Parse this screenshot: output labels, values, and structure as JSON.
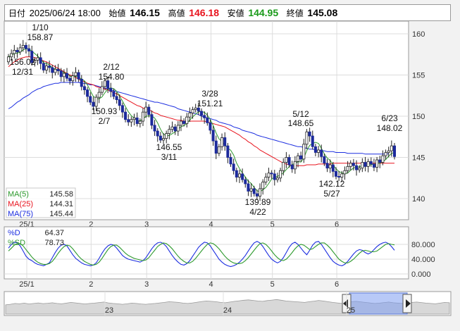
{
  "header": {
    "date_label": "日付",
    "datetime": "2025/06/24 18:00",
    "open_label": "始値",
    "open": "146.15",
    "high_label": "高値",
    "high": "146.18",
    "low_label": "安値",
    "low": "144.95",
    "close_label": "終値",
    "close": "145.08"
  },
  "colors": {
    "up": "#ffffff",
    "down": "#1c2a9c",
    "ma5": "#2e9a2e",
    "ma25": "#e8141e",
    "ma75": "#1c2ee0",
    "pctd": "#1c2ee0",
    "pctsd": "#2e9a2e"
  },
  "chart_data": [
    {
      "type": "candlestick",
      "name": "price",
      "ylim": [
        137.5,
        162.5
      ],
      "yticks": [
        "160",
        "155",
        "150",
        "145",
        "140"
      ],
      "xticks": [
        "25/1",
        "2",
        "3",
        "4",
        "5",
        "6"
      ],
      "legend": [
        {
          "label": "MA(5)",
          "value": "145.58"
        },
        {
          "label": "MA(25)",
          "value": "144.31"
        },
        {
          "label": "MA(75)",
          "value": "145.44"
        }
      ],
      "annotations": [
        {
          "date": "1/10",
          "value": "158.87"
        },
        {
          "date": "12/31",
          "value": "156.02"
        },
        {
          "date": "2/12",
          "value": "154.80"
        },
        {
          "date": "2/7",
          "value": "150.93"
        },
        {
          "date": "3/11",
          "value": "146.55"
        },
        {
          "date": "3/28",
          "value": "151.21"
        },
        {
          "date": "4/22",
          "value": "139.89"
        },
        {
          "date": "5/12",
          "value": "148.65"
        },
        {
          "date": "5/27",
          "value": "142.12"
        },
        {
          "date": "6/23",
          "value": "148.02"
        }
      ],
      "closes": [
        157.2,
        157.6,
        158.0,
        157.8,
        158.3,
        158.6,
        158.2,
        157.9,
        156.5,
        156.8,
        157.1,
        156.4,
        155.6,
        156.1,
        155.9,
        155.3,
        155.7,
        155.5,
        154.8,
        155.2,
        154.6,
        154.3,
        154.9,
        155.3,
        154.5,
        153.6,
        153.2,
        152.4,
        151.7,
        151.2,
        152.3,
        152.9,
        153.6,
        154.3,
        153.4,
        153.0,
        152.4,
        152.0,
        151.3,
        150.5,
        149.6,
        149.3,
        149.6,
        149.8,
        149.1,
        149.4,
        150.5,
        151.1,
        150.2,
        148.9,
        148.2,
        147.6,
        147.1,
        147.3,
        147.9,
        148.4,
        148.7,
        148.2,
        148.9,
        149.4,
        149.1,
        149.9,
        150.4,
        150.8,
        151.0,
        150.6,
        150.1,
        149.8,
        149.2,
        148.3,
        147.0,
        145.5,
        146.3,
        147.4,
        146.4,
        145.0,
        144.2,
        143.4,
        142.6,
        143.0,
        142.3,
        141.8,
        140.9,
        141.2,
        140.6,
        140.3,
        141.2,
        142.0,
        142.6,
        143.1,
        143.0,
        142.3,
        142.5,
        143.4,
        144.4,
        145.0,
        144.1,
        143.6,
        144.5,
        145.2,
        144.8,
        146.6,
        148.1,
        147.6,
        146.3,
        145.6,
        145.9,
        145.1,
        144.3,
        143.7,
        144.1,
        143.3,
        142.7,
        142.6,
        143.0,
        143.4,
        143.9,
        144.3,
        144.0,
        143.5,
        143.7,
        144.4,
        143.9,
        144.5,
        144.2,
        143.8,
        144.7,
        144.4,
        145.2,
        145.6,
        145.8,
        146.4,
        145.1
      ],
      "ma25": [
        156.0,
        156.3,
        156.6,
        156.8,
        157.0,
        157.1,
        157.2,
        157.2,
        157.2,
        157.1,
        157.0,
        156.9,
        156.7,
        156.6,
        156.4,
        156.2,
        156.0,
        155.8,
        155.6,
        155.4,
        155.2,
        155.0,
        154.9,
        154.7,
        154.5,
        154.3,
        154.2,
        154.0,
        153.9,
        153.8,
        153.6,
        153.5,
        153.4,
        153.3,
        153.2,
        153.0,
        152.9,
        152.7,
        152.5,
        152.3,
        152.1,
        151.9,
        151.7,
        151.5,
        151.3,
        151.2,
        151.0,
        150.9,
        150.8,
        150.6,
        150.4,
        150.3,
        150.1,
        150.0,
        149.9,
        149.8,
        149.7,
        149.6,
        149.5,
        149.5,
        149.4,
        149.4,
        149.4,
        149.4,
        149.4,
        149.4,
        149.4,
        149.4,
        149.3,
        149.2,
        149.1,
        149.0,
        148.9,
        148.8,
        148.7,
        148.5,
        148.3,
        148.1,
        147.9,
        147.7,
        147.4,
        147.2,
        146.9,
        146.7,
        146.4,
        146.2,
        145.9,
        145.7,
        145.5,
        145.3,
        145.1,
        144.9,
        144.7,
        144.5,
        144.3,
        144.2,
        144.1,
        144.0,
        144.0,
        144.0,
        144.0,
        144.0,
        144.1,
        144.1,
        144.1,
        144.1,
        144.2,
        144.2,
        144.2,
        144.2,
        144.2,
        144.3,
        144.3,
        144.3,
        144.3,
        144.3,
        144.3,
        144.3,
        144.3,
        144.3,
        144.3,
        144.3,
        144.3,
        144.3,
        144.3,
        144.3,
        144.3,
        144.3,
        144.3,
        144.3,
        144.3,
        144.3,
        144.3
      ],
      "ma75": [
        150.9,
        151.1,
        151.4,
        151.7,
        151.9,
        152.2,
        152.4,
        152.6,
        152.9,
        153.1,
        153.3,
        153.4,
        153.6,
        153.7,
        153.8,
        153.9,
        154.0,
        154.0,
        154.1,
        154.1,
        154.1,
        154.1,
        154.1,
        154.1,
        154.1,
        154.0,
        154.0,
        153.9,
        153.8,
        153.8,
        153.7,
        153.6,
        153.5,
        153.4,
        153.3,
        153.2,
        153.1,
        153.0,
        152.9,
        152.8,
        152.7,
        152.6,
        152.5,
        152.4,
        152.3,
        152.2,
        152.1,
        152.0,
        151.9,
        151.8,
        151.7,
        151.7,
        151.6,
        151.5,
        151.4,
        151.3,
        151.2,
        151.1,
        150.9,
        150.8,
        150.7,
        150.6,
        150.5,
        150.4,
        150.3,
        150.2,
        150.0,
        149.9,
        149.8,
        149.7,
        149.6,
        149.5,
        149.3,
        149.2,
        149.1,
        149.0,
        148.9,
        148.7,
        148.6,
        148.5,
        148.3,
        148.2,
        148.1,
        148.0,
        147.9,
        147.7,
        147.6,
        147.5,
        147.4,
        147.3,
        147.2,
        147.1,
        147.0,
        146.9,
        146.8,
        146.7,
        146.6,
        146.5,
        146.4,
        146.3,
        146.3,
        146.2,
        146.1,
        146.0,
        146.0,
        145.9,
        145.9,
        145.8,
        145.8,
        145.7,
        145.7,
        145.7,
        145.6,
        145.6,
        145.6,
        145.6,
        145.5,
        145.5,
        145.5,
        145.5,
        145.5,
        145.5,
        145.4,
        145.4,
        145.4,
        145.4,
        145.4,
        145.4,
        145.4,
        145.4,
        145.44
      ]
    },
    {
      "type": "line",
      "name": "stochastics",
      "ylim": [
        0,
        100
      ],
      "yticks": [
        "80.000",
        "40.000",
        "0.000"
      ],
      "xticks": [
        "25/1",
        "2",
        "3",
        "4",
        "5",
        "6"
      ],
      "legend": [
        {
          "label": "%D",
          "value": "64.37"
        },
        {
          "label": "%SD",
          "value": "78.73"
        }
      ],
      "series": [
        {
          "name": "%D",
          "values": [
            70,
            80,
            86,
            84,
            76,
            62,
            48,
            40,
            36,
            30,
            26,
            24,
            22,
            26,
            30,
            44,
            58,
            70,
            78,
            80,
            76,
            64,
            52,
            42,
            36,
            30,
            26,
            24,
            22,
            24,
            30,
            42,
            56,
            68,
            76,
            80,
            78,
            70,
            60,
            50,
            44,
            40,
            38,
            36,
            34,
            32,
            36,
            44,
            56,
            68,
            78,
            84,
            86,
            82,
            74,
            62,
            50,
            40,
            32,
            26,
            24,
            28,
            36,
            48,
            60,
            72,
            80,
            86,
            84,
            76,
            64,
            52,
            40,
            32,
            26,
            22,
            20,
            22,
            26,
            32,
            40,
            50,
            62,
            74,
            84,
            88,
            84,
            74,
            62,
            50,
            40,
            34,
            30,
            34,
            44,
            58,
            72,
            82,
            86,
            80,
            70,
            60,
            52,
            64,
            78,
            86,
            88,
            80,
            68,
            56,
            44,
            34,
            28,
            24,
            22,
            26,
            34,
            44,
            54,
            62,
            66,
            64,
            58,
            54,
            58,
            66,
            74,
            80,
            84,
            86,
            82,
            74,
            64
          ]
        },
        {
          "name": "%SD",
          "values": [
            62,
            70,
            78,
            82,
            82,
            76,
            66,
            56,
            46,
            38,
            32,
            28,
            26,
            26,
            28,
            34,
            44,
            56,
            66,
            74,
            78,
            76,
            68,
            58,
            48,
            40,
            34,
            30,
            26,
            24,
            26,
            32,
            42,
            54,
            66,
            74,
            78,
            78,
            72,
            64,
            56,
            50,
            46,
            42,
            40,
            38,
            36,
            38,
            44,
            54,
            64,
            74,
            80,
            84,
            82,
            76,
            68,
            58,
            48,
            40,
            34,
            30,
            30,
            34,
            42,
            52,
            62,
            72,
            80,
            84,
            82,
            76,
            68,
            58,
            48,
            40,
            34,
            30,
            28,
            28,
            30,
            36,
            44,
            54,
            64,
            74,
            82,
            84,
            80,
            72,
            62,
            52,
            44,
            38,
            36,
            40,
            48,
            58,
            68,
            76,
            80,
            78,
            72,
            66,
            68,
            74,
            80,
            84,
            84,
            78,
            70,
            60,
            50,
            40,
            34,
            30,
            30,
            34,
            40,
            48,
            56,
            62,
            64,
            62,
            60,
            60,
            62,
            68,
            74,
            80,
            82,
            80,
            78.73
          ]
        }
      ]
    },
    {
      "type": "area",
      "name": "overview",
      "xticks": [
        "23",
        "24",
        "25"
      ],
      "values": [
        0.52,
        0.55,
        0.6,
        0.58,
        0.62,
        0.57,
        0.6,
        0.63,
        0.59,
        0.61,
        0.64,
        0.6,
        0.58,
        0.62,
        0.66,
        0.63,
        0.6,
        0.57,
        0.6,
        0.62,
        0.65,
        0.68,
        0.63,
        0.6,
        0.58,
        0.55,
        0.58,
        0.62,
        0.6,
        0.57,
        0.55,
        0.58,
        0.6,
        0.63,
        0.66,
        0.7,
        0.68,
        0.66,
        0.62,
        0.6,
        0.63,
        0.67,
        0.71,
        0.74,
        0.72,
        0.7,
        0.66,
        0.64,
        0.68,
        0.72,
        0.75,
        0.78,
        0.8,
        0.77,
        0.74,
        0.72,
        0.76,
        0.79,
        0.82,
        0.78,
        0.74,
        0.72,
        0.7,
        0.68,
        0.66,
        0.7,
        0.73,
        0.77,
        0.74,
        0.7,
        0.66,
        0.63,
        0.6,
        0.65,
        0.7,
        0.72,
        0.69,
        0.66,
        0.63,
        0.6,
        0.62,
        0.65,
        0.68,
        0.64,
        0.62,
        0.6,
        0.63,
        0.66,
        0.68,
        0.65,
        0.62,
        0.6,
        0.58,
        0.62,
        0.66,
        0.64
      ]
    }
  ]
}
